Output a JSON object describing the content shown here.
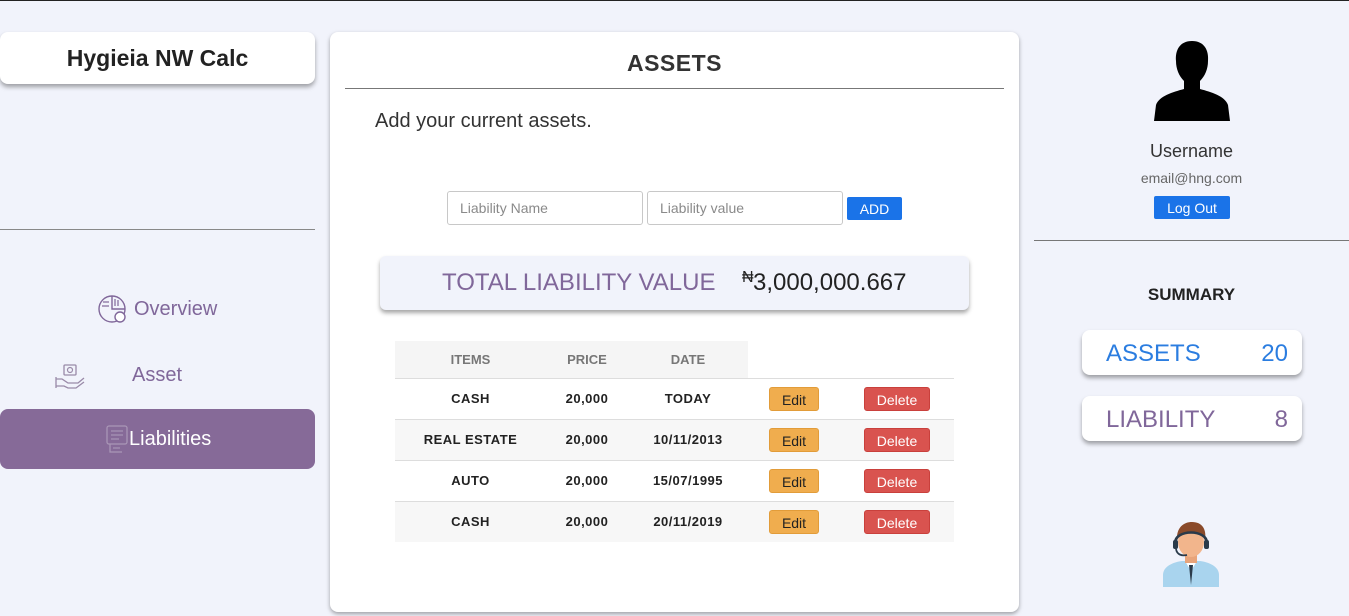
{
  "brand": {
    "title": "Hygieia NW Calc"
  },
  "nav": {
    "overview": "Overview",
    "asset": "Asset",
    "liabilities": "Liabilities"
  },
  "main": {
    "title": "ASSETS",
    "subtitle": "Add your current assets.",
    "form": {
      "name_placeholder": "Liability Name",
      "value_placeholder": "Liability value",
      "add_label": "ADD"
    },
    "total": {
      "label": "TOTAL LIABILITY VALUE",
      "currency": "₦",
      "value": "3,000,000.667"
    },
    "table": {
      "headers": [
        "ITEMS",
        "PRICE",
        "DATE"
      ],
      "edit_label": "Edit",
      "delete_label": "Delete",
      "rows": [
        {
          "item": "CASH",
          "price": "20,000",
          "date": "TODAY"
        },
        {
          "item": "REAL ESTATE",
          "price": "20,000",
          "date": "10/11/2013"
        },
        {
          "item": "AUTO",
          "price": "20,000",
          "date": "15/07/1995"
        },
        {
          "item": "CASH",
          "price": "20,000",
          "date": "20/11/2019"
        }
      ]
    }
  },
  "profile": {
    "username": "Username",
    "email": "email@hng.com",
    "logout_label": "Log Out"
  },
  "summary": {
    "title": "SUMMARY",
    "assets_label": "ASSETS",
    "assets_count": "20",
    "liability_label": "LIABILITY",
    "liability_count": "8"
  },
  "colors": {
    "accent_purple": "#866a98",
    "primary_blue": "#1a73e8",
    "edit_orange": "#f0ad4e",
    "delete_red": "#d9534f",
    "background": "#f1f3fb"
  },
  "icons": {
    "overview": "pie-chart-icon",
    "asset": "hand-holding-money-icon",
    "liabilities": "bill-icon",
    "avatar": "user-silhouette-icon",
    "support": "support-agent-icon"
  }
}
